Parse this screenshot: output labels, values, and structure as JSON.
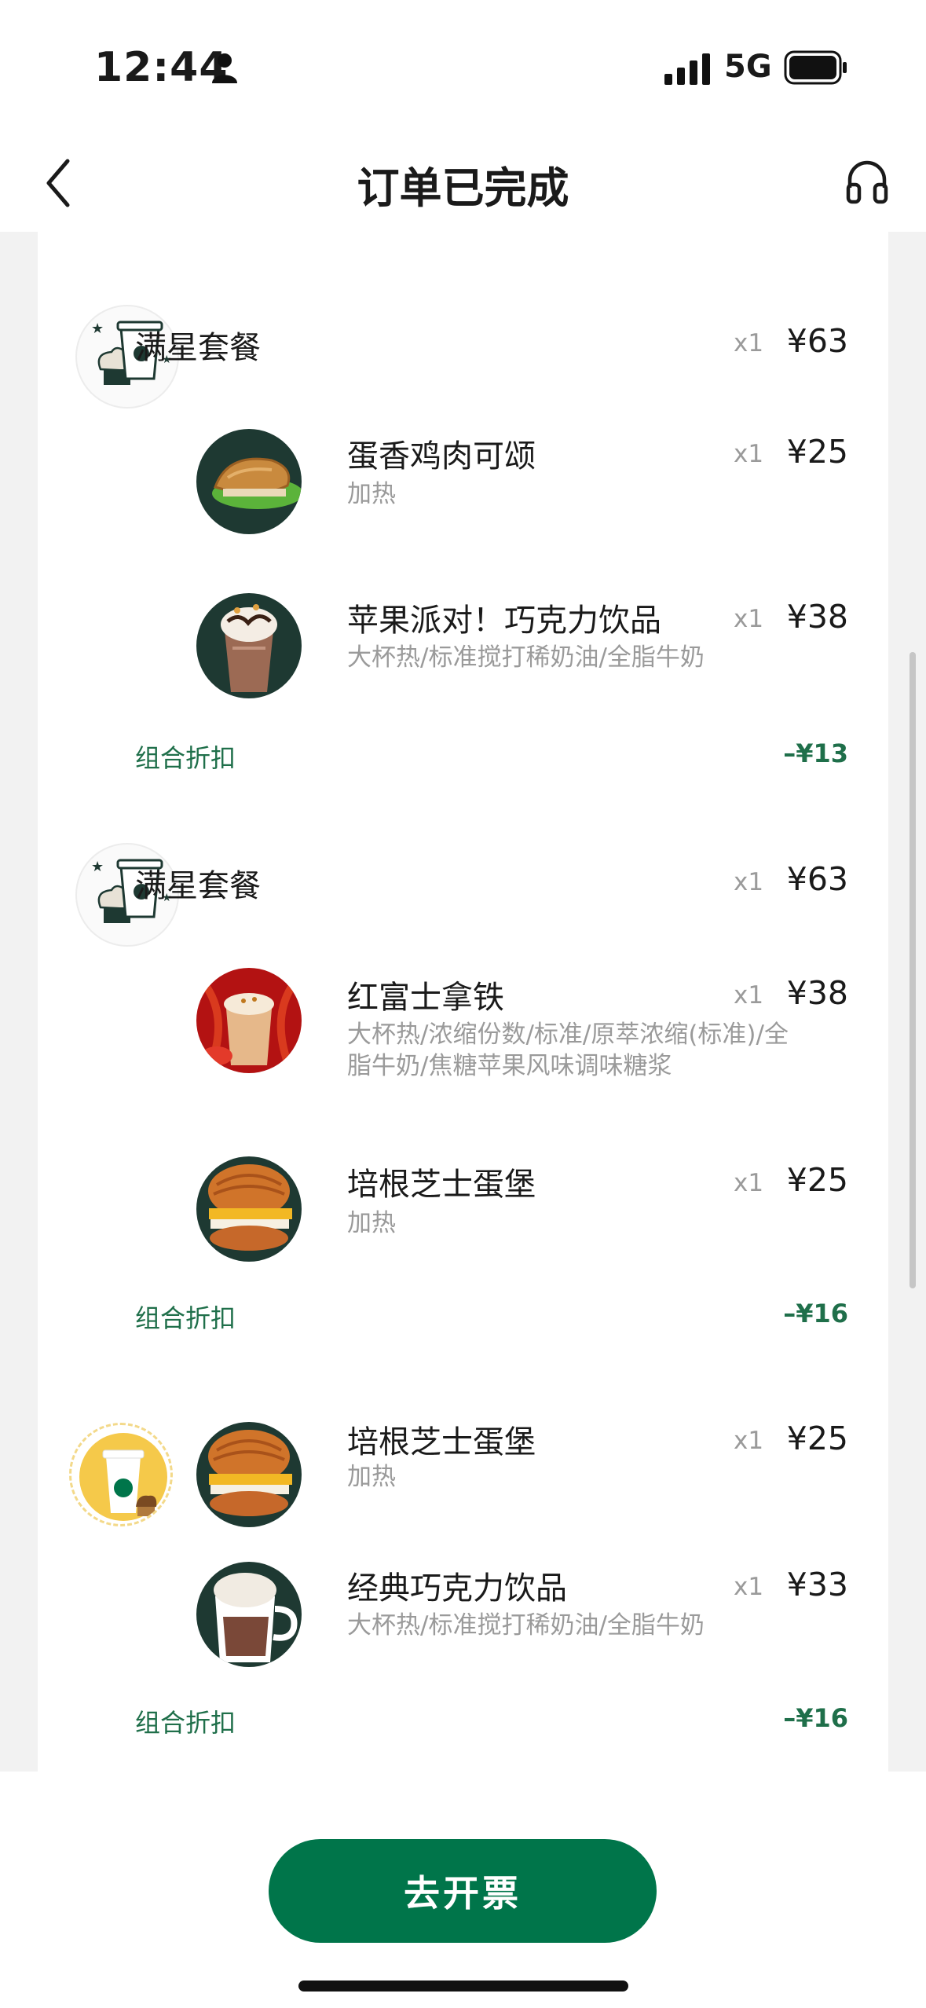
{
  "status_bar": {
    "time": "12:44",
    "network": "5G"
  },
  "nav": {
    "title": "订单已完成",
    "back_icon": "chevron-left-icon",
    "service_icon": "headset-icon"
  },
  "groups": [
    {
      "combo_name": "满星套餐",
      "combo_qty": "x1",
      "combo_price": "¥63",
      "items": [
        {
          "name": "蛋香鸡肉可颂",
          "qty": "x1",
          "price": "¥25",
          "options": "加热"
        },
        {
          "name": "苹果派对！巧克力饮品",
          "qty": "x1",
          "price": "¥38",
          "options": "大杯热/标准搅打稀奶油/全脂牛奶"
        }
      ],
      "discount_label": "组合折扣",
      "discount_value": "–¥13"
    },
    {
      "combo_name": "满星套餐",
      "combo_qty": "x1",
      "combo_price": "¥63",
      "items": [
        {
          "name": "红富士拿铁",
          "qty": "x1",
          "price": "¥38",
          "options_line1": "大杯热/浓缩份数/标准/原萃浓缩(标准)/全",
          "options_line2": "脂牛奶/焦糖苹果风味调味糖浆"
        },
        {
          "name": "培根芝士蛋堡",
          "qty": "x1",
          "price": "¥25",
          "options": "加热"
        }
      ],
      "discount_label": "组合折扣",
      "discount_value": "–¥16"
    },
    {
      "items": [
        {
          "name": "培根芝士蛋堡",
          "qty": "x1",
          "price": "¥25",
          "options": "加热"
        },
        {
          "name": "经典巧克力饮品",
          "qty": "x1",
          "price": "¥33",
          "options": "大杯热/标准搅打稀奶油/全脂牛奶"
        }
      ],
      "discount_label": "组合折扣",
      "discount_value": "–¥16"
    }
  ],
  "footer": {
    "invoice_button": "去开票"
  },
  "colors": {
    "starbucks_green": "#00754a",
    "discount_green": "#1f6f4a",
    "muted": "#9a9a9a"
  }
}
